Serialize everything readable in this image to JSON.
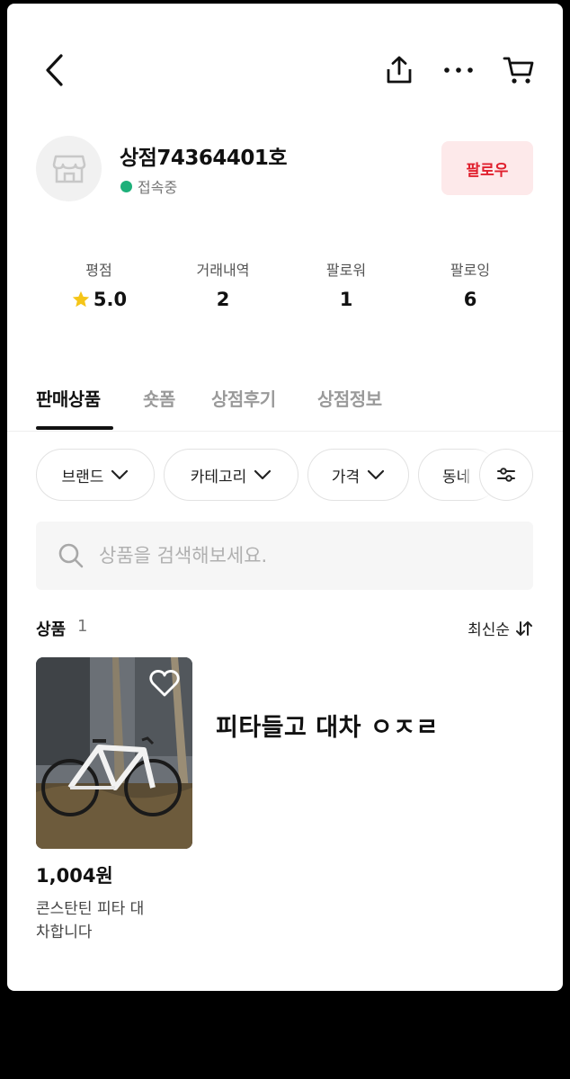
{
  "shop": {
    "name": "상점74364401호",
    "status": "접속중",
    "follow_label": "팔로우",
    "status_color": "#1db07a",
    "follow_color": "#e0202e"
  },
  "stats": [
    {
      "label": "평점",
      "value": "5.0",
      "icon": "star-icon"
    },
    {
      "label": "거래내역",
      "value": "2"
    },
    {
      "label": "팔로워",
      "value": "1"
    },
    {
      "label": "팔로잉",
      "value": "6"
    }
  ],
  "tabs": [
    {
      "label": "판매상품",
      "active": true
    },
    {
      "label": "숏폼"
    },
    {
      "label": "상점후기"
    },
    {
      "label": "상점정보"
    }
  ],
  "filters": [
    "브랜드",
    "카테고리",
    "가격",
    "동네"
  ],
  "search": {
    "placeholder": "상품을 검색해보세요."
  },
  "products_header": {
    "title": "상품",
    "count": "1",
    "sort": "최신순"
  },
  "product": {
    "price": "1,004원",
    "name": "콘스탄틴 피타 대차합니다",
    "image": "bicycle-photo"
  },
  "overlay_text": "피타들고 대차 ㅇㅈㄹ"
}
